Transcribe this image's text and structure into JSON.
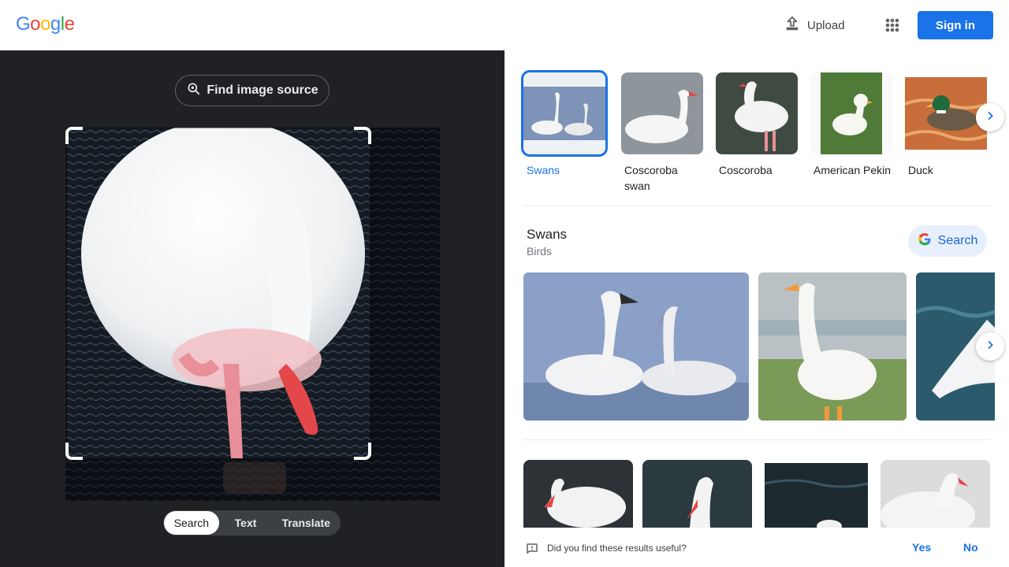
{
  "header": {
    "logo_letters": [
      {
        "ch": "G",
        "color": "#4285f4"
      },
      {
        "ch": "o",
        "color": "#ea4335"
      },
      {
        "ch": "o",
        "color": "#fbbc05"
      },
      {
        "ch": "g",
        "color": "#4285f4"
      },
      {
        "ch": "l",
        "color": "#34a853"
      },
      {
        "ch": "e",
        "color": "#ea4335"
      }
    ],
    "upload_label": "Upload",
    "signin_label": "Sign in",
    "brand_blue": "#1a73e8"
  },
  "lens": {
    "find_source_label": "Find image source",
    "modes": [
      {
        "label": "Search",
        "active": true
      },
      {
        "label": "Text",
        "active": false
      },
      {
        "label": "Translate",
        "active": false
      }
    ]
  },
  "chips": [
    {
      "label": "Swans",
      "selected": true
    },
    {
      "label": "Coscoroba swan",
      "selected": false
    },
    {
      "label": "Coscoroba",
      "selected": false
    },
    {
      "label": "American Pekin",
      "selected": false
    },
    {
      "label": "Duck",
      "selected": false
    }
  ],
  "entity": {
    "title": "Swans",
    "subtitle": "Birds",
    "search_label": "Search"
  },
  "feedback": {
    "question": "Did you find these results useful?",
    "yes_label": "Yes",
    "no_label": "No"
  }
}
